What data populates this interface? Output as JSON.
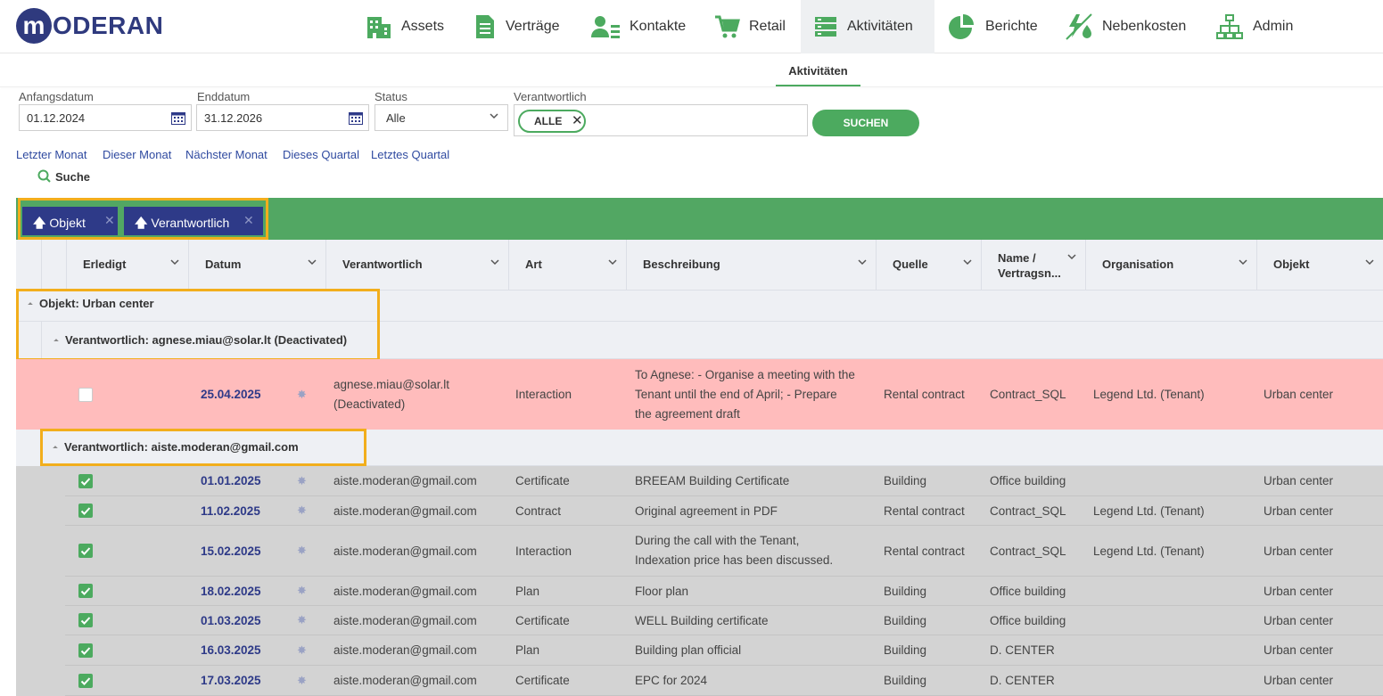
{
  "logo": {
    "letter": "m",
    "text": "ODERAN"
  },
  "nav": [
    {
      "label": "Assets"
    },
    {
      "label": "Verträge"
    },
    {
      "label": "Kontakte"
    },
    {
      "label": "Retail"
    },
    {
      "label": "Aktivitäten"
    },
    {
      "label": "Berichte"
    },
    {
      "label": "Nebenkosten"
    },
    {
      "label": "Admin"
    }
  ],
  "subtab": "Aktivitäten",
  "filters": {
    "start_label": "Anfangsdatum",
    "start_value": "01.12.2024",
    "end_label": "Enddatum",
    "end_value": "31.12.2026",
    "status_label": "Status",
    "status_value": "Alle",
    "resp_label": "Verantwortlich",
    "resp_chip": "ALLE",
    "search_button": "SUCHEN"
  },
  "quick_links": [
    "Letzter Monat",
    "Dieser Monat",
    "Nächster Monat",
    "Dieses Quartal",
    "Letztes Quartal"
  ],
  "search_link": "Suche",
  "group_chips": [
    "Objekt",
    "Verantwortlich"
  ],
  "columns": [
    "Erledigt",
    "Datum",
    "Verantwortlich",
    "Art",
    "Beschreibung",
    "Quelle",
    "Name /",
    "Vertragsn...",
    "Organisation",
    "Objekt"
  ],
  "groups": {
    "object": "Objekt: Urban center",
    "resp1": "Verantwortlich: agnese.miau@solar.lt (Deactivated)",
    "resp2": "Verantwortlich: aiste.moderan@gmail.com"
  },
  "rows": [
    {
      "done": false,
      "date": "25.04.2025",
      "resp1": "agnese.miau@solar.lt",
      "resp2": "(Deactivated)",
      "type": "Interaction",
      "desc1": "To Agnese: - Organise a meeting with the",
      "desc2": "Tenant until the end of April; - Prepare",
      "desc3": "the agreement draft",
      "source": "Rental contract",
      "name": "Contract_SQL",
      "org": "Legend Ltd. (Tenant)",
      "object": "Urban center"
    },
    {
      "done": true,
      "date": "01.01.2025",
      "resp1": "aiste.moderan@gmail.com",
      "type": "Certificate",
      "desc1": "BREEAM Building Certificate",
      "source": "Building",
      "name": "Office building",
      "org": "",
      "object": "Urban center"
    },
    {
      "done": true,
      "date": "11.02.2025",
      "resp1": "aiste.moderan@gmail.com",
      "type": "Contract",
      "desc1": "Original agreement in PDF",
      "source": "Rental contract",
      "name": "Contract_SQL",
      "org": "Legend Ltd. (Tenant)",
      "object": "Urban center"
    },
    {
      "done": true,
      "date": "15.02.2025",
      "resp1": "aiste.moderan@gmail.com",
      "type": "Interaction",
      "desc1": "During the call with the Tenant,",
      "desc2": "Indexation price has been discussed.",
      "source": "Rental contract",
      "name": "Contract_SQL",
      "org": "Legend Ltd. (Tenant)",
      "object": "Urban center"
    },
    {
      "done": true,
      "date": "18.02.2025",
      "resp1": "aiste.moderan@gmail.com",
      "type": "Plan",
      "desc1": "Floor plan",
      "source": "Building",
      "name": "Office building",
      "org": "",
      "object": "Urban center"
    },
    {
      "done": true,
      "date": "01.03.2025",
      "resp1": "aiste.moderan@gmail.com",
      "type": "Certificate",
      "desc1": "WELL Building certificate",
      "source": "Building",
      "name": "Office building",
      "org": "",
      "object": "Urban center"
    },
    {
      "done": true,
      "date": "16.03.2025",
      "resp1": "aiste.moderan@gmail.com",
      "type": "Plan",
      "desc1": "Building plan official",
      "source": "Building",
      "name": "D. CENTER",
      "org": "",
      "object": "Urban center"
    },
    {
      "done": true,
      "date": "17.03.2025",
      "resp1": "aiste.moderan@gmail.com",
      "type": "Certificate",
      "desc1": "EPC for 2024",
      "source": "Building",
      "name": "D. CENTER",
      "org": "",
      "object": "Urban center"
    }
  ],
  "colors": {
    "accent_green": "#4caa5f",
    "navy": "#2e3a88",
    "highlight_orange": "#f2ae1c",
    "overdue_row": "#ffbcbc",
    "done_row": "#d3d3d3"
  }
}
